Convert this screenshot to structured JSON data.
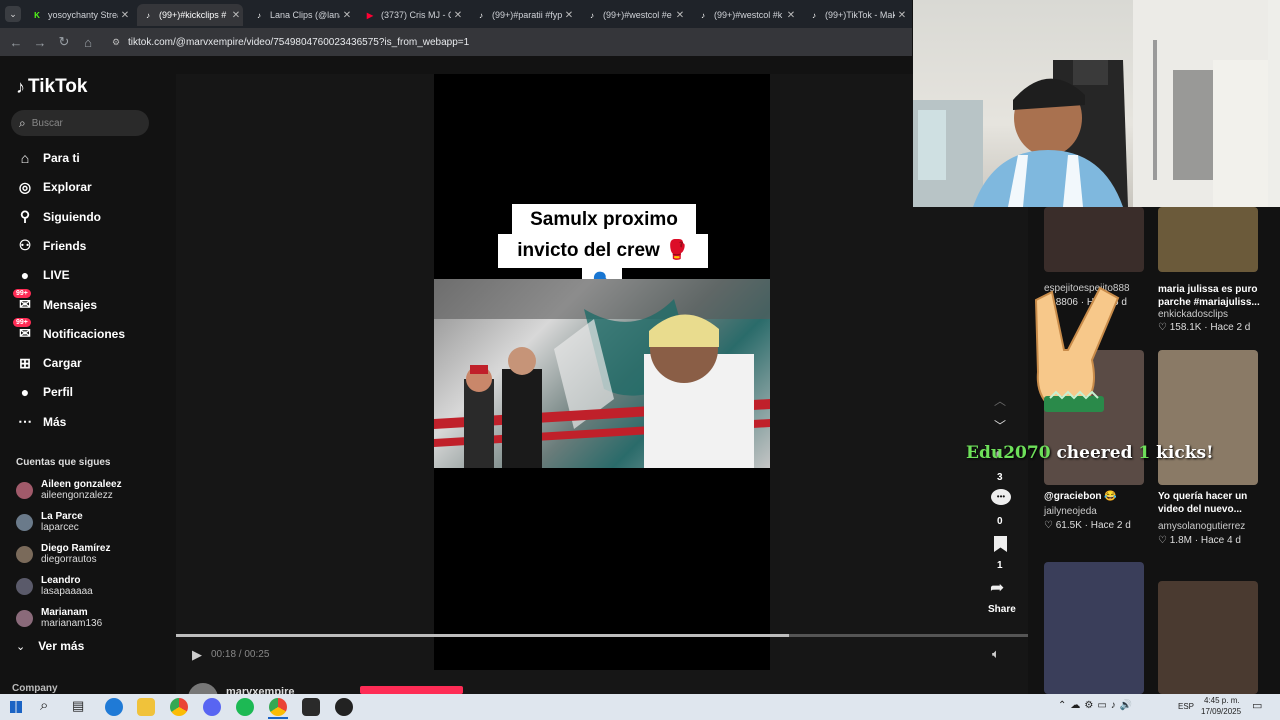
{
  "tabs": [
    {
      "title": "yosoychanty Strea",
      "favicon_color": "#53fc18",
      "favicon_glyph": "K"
    },
    {
      "title": "(99+)#kickclips #",
      "favicon_color": "#ffffff",
      "favicon_glyph": "♪"
    },
    {
      "title": "Lana Clips (@lana",
      "favicon_color": "#ffffff",
      "favicon_glyph": "♪"
    },
    {
      "title": "(3737) Cris MJ - C",
      "favicon_color": "#ff0033",
      "favicon_glyph": "▶"
    },
    {
      "title": "(99+)#paratii #fyp",
      "favicon_color": "#ffffff",
      "favicon_glyph": "♪"
    },
    {
      "title": "(99+)#westcol #e",
      "favicon_color": "#ffffff",
      "favicon_glyph": "♪"
    },
    {
      "title": "(99+)#westcol #k",
      "favicon_color": "#ffffff",
      "favicon_glyph": "♪"
    },
    {
      "title": "(99+)TikTok - Mak",
      "favicon_color": "#ffffff",
      "favicon_glyph": "♪"
    }
  ],
  "address": {
    "url": "tiktok.com/@marvxempire/video/7549804760023436575?is_from_webapp=1"
  },
  "sidebar": {
    "logo": "TikTok",
    "search_placeholder": "Buscar",
    "nav": [
      {
        "label": "Para ti",
        "icon": "home-icon"
      },
      {
        "label": "Explorar",
        "icon": "compass-icon"
      },
      {
        "label": "Siguiendo",
        "icon": "following-icon"
      },
      {
        "label": "Friends",
        "icon": "friends-icon"
      },
      {
        "label": "LIVE",
        "icon": "live-icon"
      },
      {
        "label": "Mensajes",
        "icon": "messages-icon",
        "badge": "99+"
      },
      {
        "label": "Notificaciones",
        "icon": "inbox-icon",
        "badge": "99+"
      },
      {
        "label": "Cargar",
        "icon": "upload-icon"
      },
      {
        "label": "Perfil",
        "icon": "profile-icon"
      },
      {
        "label": "Más",
        "icon": "more-icon"
      }
    ],
    "following_title": "Cuentas que sigues",
    "following": [
      {
        "name": "Aileen gonzaleez",
        "handle": "aileengonzalezz"
      },
      {
        "name": "La Parce",
        "handle": "laparcec"
      },
      {
        "name": "Diego Ramírez",
        "handle": "diegorrautos"
      },
      {
        "name": "Leandro",
        "handle": "lasapaaaaa"
      },
      {
        "name": "Marianam",
        "handle": "marianam136"
      }
    ],
    "see_more": "Ver más",
    "company": "Company"
  },
  "video": {
    "caption_line1": "Samulx proximo",
    "caption_line2": "invicto del crew 🥊",
    "caption_emoji": "🗣️",
    "time": "00:18 / 00:25",
    "progress": 0.72,
    "author": "marvxempire"
  },
  "actions": {
    "likes": "3",
    "comments": "0",
    "saves": "1",
    "share_label": "Share"
  },
  "overlay": {
    "cheer_user": "Edu2070",
    "cheer_text": "cheered",
    "cheer_amount": "1",
    "cheer_unit": "kicks!"
  },
  "recommendations": [
    {
      "title": "",
      "user": "espejitoespejito888",
      "stats": "8806 · Hace 5 d",
      "thumb_color": "#3a2d2a"
    },
    {
      "title": "maria julissa es puro parche #mariajuliss...",
      "user": "enkickadosclips",
      "stats": "158.1K · Hace 2 d",
      "thumb_color": "#6b5a3a"
    },
    {
      "title": "@graciebon 😂",
      "user": "jailyneojeda",
      "stats": "61.5K · Hace 2 d",
      "thumb_color": "#5a4b45"
    },
    {
      "title": "Yo quería hacer un video del nuevo...",
      "user": "amysolanogutierrez",
      "stats": "1.8M · Hace 4 d",
      "thumb_color": "#8a7a66"
    },
    {
      "title": "",
      "user": "",
      "stats": "",
      "thumb_color": "#3a3e5a"
    },
    {
      "title": "",
      "user": "",
      "stats": "",
      "thumb_color": "#4a3a30"
    }
  ],
  "clock": {
    "time": "4:45 p. m.",
    "date": "17/09/2025",
    "lang": "ESP"
  }
}
